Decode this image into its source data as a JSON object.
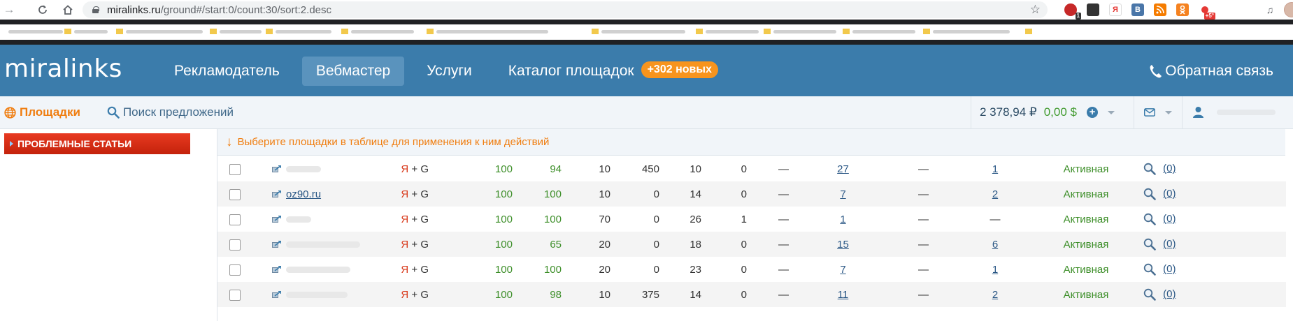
{
  "browser": {
    "url_host": "miralinks.ru",
    "url_path": "/ground#/start:0/count:30/sort:2.desc",
    "extensions": [
      {
        "name": "ext-red-icon",
        "color": "#d93025",
        "glyph": "",
        "badge": "1"
      },
      {
        "name": "ext-tag-icon",
        "color": "#333333",
        "glyph": "",
        "badge": ""
      },
      {
        "name": "ext-yandex-icon",
        "color": "#e53935",
        "glyph": "Я",
        "badge": ""
      },
      {
        "name": "ext-vk-icon",
        "color": "#4a76a8",
        "glyph": "B",
        "badge": ""
      },
      {
        "name": "ext-rss-icon",
        "color": "#f57c00",
        "glyph": "",
        "badge": ""
      },
      {
        "name": "ext-ok-icon",
        "color": "#f58220",
        "glyph": "",
        "badge": ""
      },
      {
        "name": "ext-weather-icon",
        "color": "#e53935",
        "glyph": "",
        "badge": "+5°"
      }
    ]
  },
  "header": {
    "logo": "miralinks",
    "nav": [
      {
        "label": "Рекламодатель",
        "active": false
      },
      {
        "label": "Вебмастер",
        "active": true
      },
      {
        "label": "Услуги",
        "active": false
      },
      {
        "label": "Каталог площадок",
        "active": false
      }
    ],
    "new_badge": "+302 новых",
    "feedback": "Обратная связь"
  },
  "subbar": {
    "sites": "Площадки",
    "search": "Поиск предложений",
    "balance_rub": "2 378,94 ₽",
    "balance_usd": "0,00 $"
  },
  "sidebar": {
    "problem_articles": "ПРОБЛЕМНЫЕ СТАТЬИ"
  },
  "hint": "Выберите площадки в таблице для применения к ним действий",
  "rows": [
    {
      "site": "",
      "blur_w": 50,
      "ya": "Я",
      "plus": "+ G",
      "c1": "100",
      "c2": "94",
      "c3": "10",
      "c4": "450",
      "c5": "10",
      "c6": "0",
      "c7": "—",
      "c8": "27",
      "c9": "—",
      "c10": "1",
      "status": "Активная",
      "reviews": "(0)"
    },
    {
      "site": "oz90.ru",
      "blur_w": 0,
      "ya": "Я",
      "plus": "+ G",
      "c1": "100",
      "c2": "100",
      "c3": "10",
      "c4": "0",
      "c5": "14",
      "c6": "0",
      "c7": "—",
      "c8": "7",
      "c9": "—",
      "c10": "2",
      "status": "Активная",
      "reviews": "(0)"
    },
    {
      "site": "",
      "blur_w": 36,
      "ya": "Я",
      "plus": "+ G",
      "c1": "100",
      "c2": "100",
      "c3": "70",
      "c4": "0",
      "c5": "26",
      "c6": "1",
      "c7": "—",
      "c8": "1",
      "c9": "—",
      "c10": "—",
      "status": "Активная",
      "reviews": "(0)"
    },
    {
      "site": "",
      "blur_w": 106,
      "ya": "Я",
      "plus": "+ G",
      "c1": "100",
      "c2": "65",
      "c3": "20",
      "c4": "0",
      "c5": "18",
      "c6": "0",
      "c7": "—",
      "c8": "15",
      "c9": "—",
      "c10": "6",
      "status": "Активная",
      "reviews": "(0)"
    },
    {
      "site": "",
      "blur_w": 92,
      "ya": "Я",
      "plus": "+ G",
      "c1": "100",
      "c2": "100",
      "c3": "20",
      "c4": "0",
      "c5": "23",
      "c6": "0",
      "c7": "—",
      "c8": "7",
      "c9": "—",
      "c10": "1",
      "status": "Активная",
      "reviews": "(0)"
    },
    {
      "site": "",
      "blur_w": 88,
      "ya": "Я",
      "plus": "+ G",
      "c1": "100",
      "c2": "98",
      "c3": "10",
      "c4": "375",
      "c5": "14",
      "c6": "0",
      "c7": "—",
      "c8": "11",
      "c9": "—",
      "c10": "2",
      "status": "Активная",
      "reviews": "(0)"
    }
  ]
}
